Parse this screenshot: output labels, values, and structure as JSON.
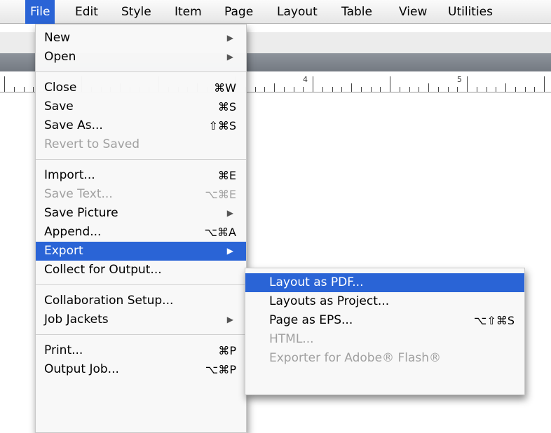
{
  "menubar": {
    "items": [
      "File",
      "Edit",
      "Style",
      "Item",
      "Page",
      "Layout",
      "Table",
      "View",
      "Utilities"
    ],
    "active": "File"
  },
  "ruler": {
    "labels": [
      "4",
      "5"
    ]
  },
  "file_menu": {
    "groups": [
      [
        {
          "label": "New",
          "shortcut": "",
          "submenu": true,
          "enabled": true
        },
        {
          "label": "Open",
          "shortcut": "",
          "submenu": true,
          "enabled": true
        }
      ],
      [
        {
          "label": "Close",
          "shortcut": "⌘W",
          "submenu": false,
          "enabled": true
        },
        {
          "label": "Save",
          "shortcut": "⌘S",
          "submenu": false,
          "enabled": true
        },
        {
          "label": "Save As...",
          "shortcut": "⇧⌘S",
          "submenu": false,
          "enabled": true
        },
        {
          "label": "Revert to Saved",
          "shortcut": "",
          "submenu": false,
          "enabled": false
        }
      ],
      [
        {
          "label": "Import...",
          "shortcut": "⌘E",
          "submenu": false,
          "enabled": true
        },
        {
          "label": "Save Text...",
          "shortcut": "⌥⌘E",
          "submenu": false,
          "enabled": false
        },
        {
          "label": "Save Picture",
          "shortcut": "",
          "submenu": true,
          "enabled": true
        },
        {
          "label": "Append...",
          "shortcut": "⌥⌘A",
          "submenu": false,
          "enabled": true
        },
        {
          "label": "Export",
          "shortcut": "",
          "submenu": true,
          "enabled": true,
          "highlighted": true
        },
        {
          "label": "Collect for Output...",
          "shortcut": "",
          "submenu": false,
          "enabled": true
        }
      ],
      [
        {
          "label": "Collaboration Setup...",
          "shortcut": "",
          "submenu": false,
          "enabled": true
        },
        {
          "label": "Job Jackets",
          "shortcut": "",
          "submenu": true,
          "enabled": true
        }
      ],
      [
        {
          "label": "Print...",
          "shortcut": "⌘P",
          "submenu": false,
          "enabled": true
        },
        {
          "label": "Output Job...",
          "shortcut": "⌥⌘P",
          "submenu": false,
          "enabled": true
        }
      ]
    ]
  },
  "export_menu": {
    "items": [
      {
        "label": "Layout as PDF...",
        "shortcut": "",
        "enabled": true,
        "highlighted": true
      },
      {
        "label": "Layouts as Project...",
        "shortcut": "",
        "enabled": true
      },
      {
        "label": "Page as EPS...",
        "shortcut": "⌥⇧⌘S",
        "enabled": true
      },
      {
        "label": "HTML...",
        "shortcut": "",
        "enabled": false
      },
      {
        "label": "Exporter for Adobe® Flash®",
        "shortcut": "",
        "enabled": false
      }
    ]
  },
  "colors": {
    "highlight": "#2a64d6",
    "disabled_text": "#a0a0a0"
  }
}
